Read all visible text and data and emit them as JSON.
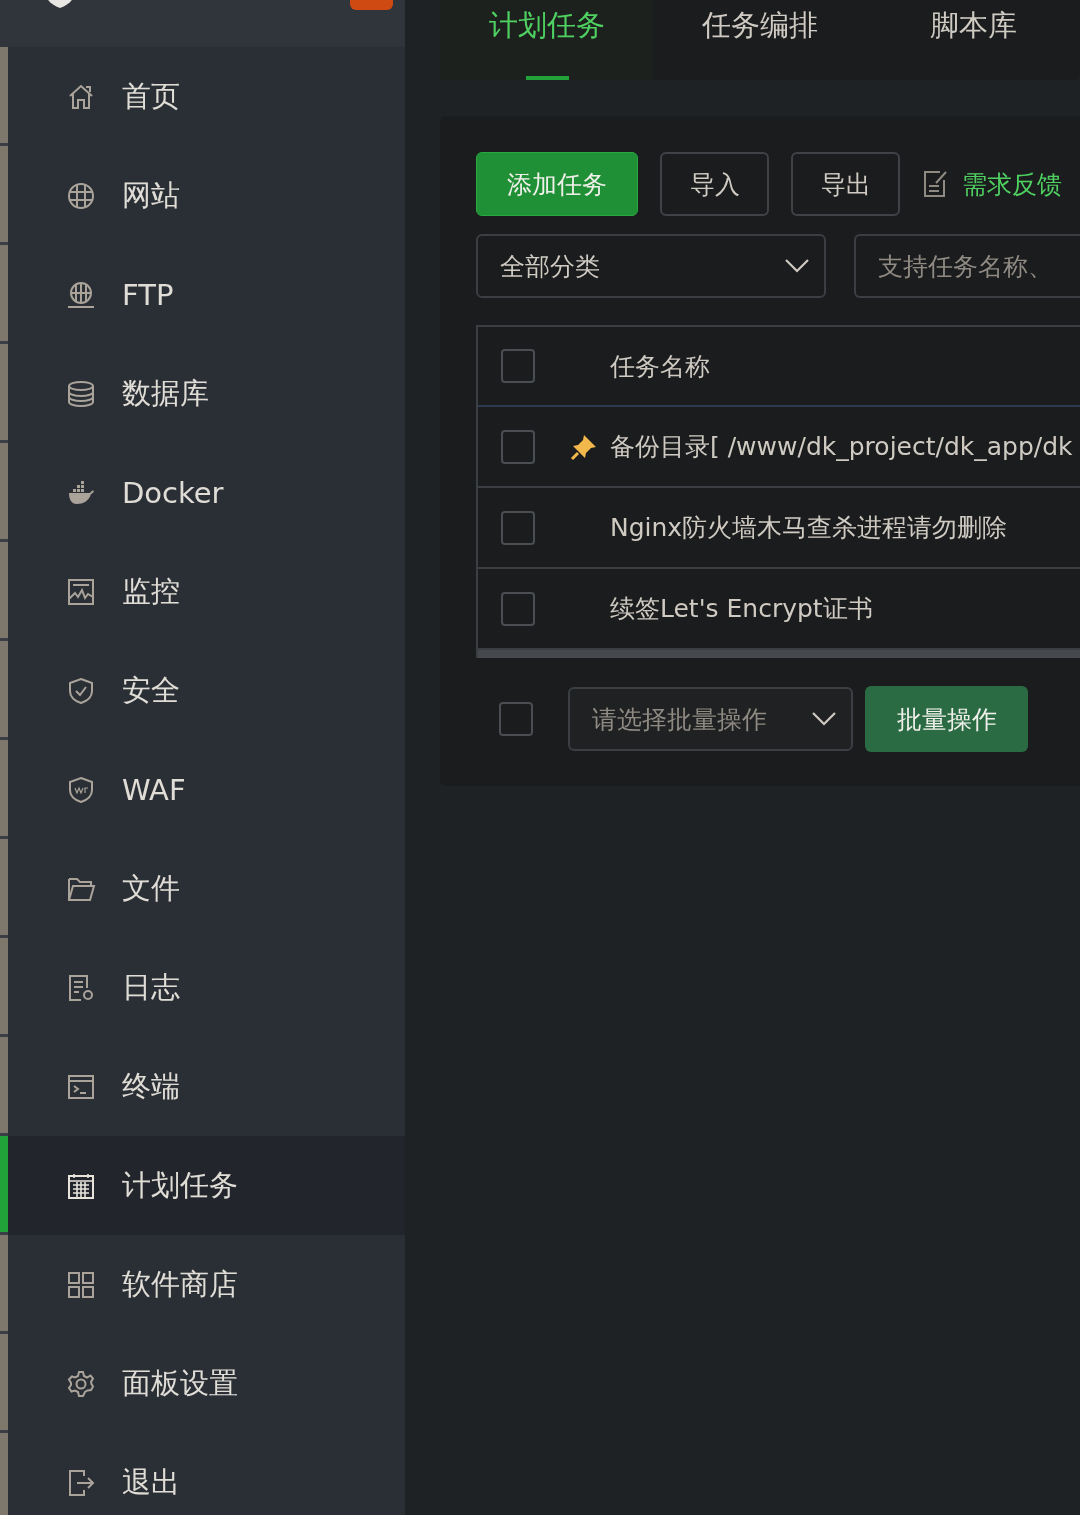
{
  "sidebar": {
    "items": [
      {
        "label": "首页",
        "selected": false
      },
      {
        "label": "网站",
        "selected": false
      },
      {
        "label": "FTP",
        "selected": false
      },
      {
        "label": "数据库",
        "selected": false
      },
      {
        "label": "Docker",
        "selected": false
      },
      {
        "label": "监控",
        "selected": false
      },
      {
        "label": "安全",
        "selected": false
      },
      {
        "label": "WAF",
        "selected": false
      },
      {
        "label": "文件",
        "selected": false
      },
      {
        "label": "日志",
        "selected": false
      },
      {
        "label": "终端",
        "selected": false
      },
      {
        "label": "计划任务",
        "selected": true
      },
      {
        "label": "软件商店",
        "selected": false
      },
      {
        "label": "面板设置",
        "selected": false
      },
      {
        "label": "退出",
        "selected": false
      }
    ]
  },
  "tabs": [
    {
      "label": "计划任务",
      "selected": true
    },
    {
      "label": "任务编排",
      "selected": false
    },
    {
      "label": "脚本库",
      "selected": false
    }
  ],
  "toolbar": {
    "buttons": [
      {
        "label": "添加任务",
        "kind": "primary"
      },
      {
        "label": "导入",
        "kind": "outline"
      },
      {
        "label": "导出",
        "kind": "outline"
      },
      {
        "label": "需求反馈",
        "kind": "link"
      }
    ]
  },
  "filters": {
    "category": {
      "value": "全部分类"
    },
    "search": {
      "placeholder": "支持任务名称、"
    }
  },
  "table": {
    "header_checked": false,
    "columns": [
      "任务名称"
    ],
    "rows": [
      {
        "name": "备份目录[ /www/dk_project/dk_app/dk",
        "pinned": true,
        "checked": false
      },
      {
        "name": "Nginx防火墙木马查杀进程请勿删除",
        "pinned": false,
        "checked": false
      },
      {
        "name": "续签Let's Encrypt证书",
        "pinned": false,
        "checked": false
      }
    ]
  },
  "bulk": {
    "checked": false,
    "select": {
      "placeholder": "请选择批量操作"
    },
    "button": "批量操作"
  }
}
